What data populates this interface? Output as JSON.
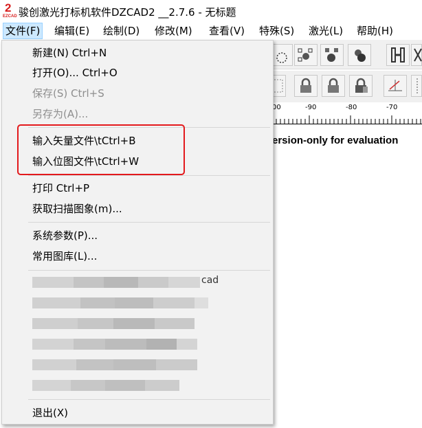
{
  "window": {
    "title": "骏创激光打标机软件DZCAD2 __2.7.6 - 无标题",
    "logo_number": "2",
    "logo_text": "EZCAD"
  },
  "menubar": {
    "items": [
      {
        "label": "文件(F)",
        "active": true
      },
      {
        "label": "编辑(E)"
      },
      {
        "label": "绘制(D)"
      },
      {
        "label": "修改(M)"
      },
      {
        "label": "查看(V)"
      },
      {
        "label": "特殊(S)"
      },
      {
        "label": "激光(L)"
      },
      {
        "label": "帮助(H)"
      }
    ]
  },
  "file_menu": {
    "items": [
      {
        "label": "新建(N) Ctrl+N",
        "enabled": true
      },
      {
        "label": "打开(O)... Ctrl+O",
        "enabled": true
      },
      {
        "label": "保存(S) Ctrl+S",
        "enabled": false
      },
      {
        "label": "另存为(A)...",
        "enabled": false
      },
      {
        "label": "输入矢量文件\\tCtrl+B",
        "enabled": true,
        "highlighted": true
      },
      {
        "label": "输入位图文件\\tCtrl+W",
        "enabled": true,
        "highlighted": true
      },
      {
        "label": "打印 Ctrl+P",
        "enabled": true
      },
      {
        "label": "获取扫描图象(m)...",
        "enabled": true
      },
      {
        "label": "系统参数(P)...",
        "enabled": true
      },
      {
        "label": "常用图库(L)...",
        "enabled": true
      },
      {
        "label": "退出(X)",
        "enabled": true
      }
    ],
    "recent_fragment": "cad"
  },
  "ruler": {
    "labels": [
      "00",
      "-90",
      "-80",
      "-70"
    ]
  },
  "canvas": {
    "watermark": "ersion-only for evaluation"
  },
  "colors": {
    "highlight_box": "#e3191c",
    "menu_active": "#cce8ff",
    "logo": "#d81e1e"
  }
}
